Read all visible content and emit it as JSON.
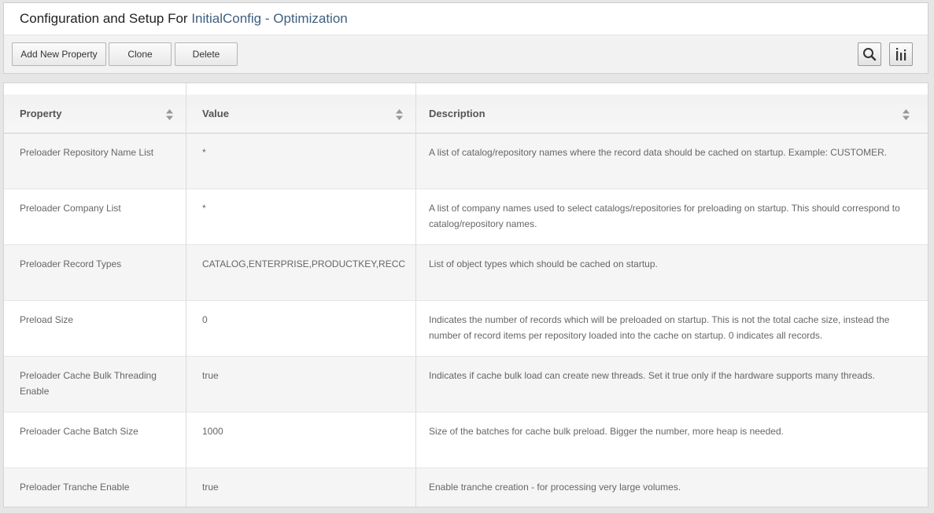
{
  "header": {
    "title_prefix": "Configuration and Setup For ",
    "config_name": "InitialConfig",
    "separator": " - ",
    "section": "Optimization"
  },
  "toolbar": {
    "add_label": "Add New Property",
    "clone_label": "Clone",
    "delete_label": "Delete",
    "search_icon": "search-icon",
    "columns_icon": "columns-icon"
  },
  "table": {
    "columns": [
      "Property",
      "Value",
      "Description"
    ],
    "rows": [
      {
        "property": "Preloader Repository Name List",
        "value": "*",
        "description": "A list of catalog/repository names where the record data should be cached on startup. Example: CUSTOMER."
      },
      {
        "property": "Preloader Company List",
        "value": "*",
        "description": "A list of company names used to select catalogs/repositories for preloading on startup. This should correspond to catalog/repository names."
      },
      {
        "property": "Preloader Record Types",
        "value": "CATALOG,ENTERPRISE,PRODUCTKEY,RECC",
        "description": "List of object types which should be cached on startup."
      },
      {
        "property": "Preload Size",
        "value": "0",
        "description": "Indicates the number of records which will be preloaded on startup. This is not the total cache size, instead the number of record items per repository loaded into the cache on startup. 0 indicates all records."
      },
      {
        "property": "Preloader Cache Bulk Threading Enable",
        "value": "true",
        "description": "Indicates if cache bulk load can create new threads. Set it true only if the hardware supports many threads."
      },
      {
        "property": "Preloader Cache Batch Size",
        "value": "1000",
        "description": "Size of the batches for cache bulk preload. Bigger the number, more heap is needed."
      },
      {
        "property": "Preloader Tranche Enable",
        "value": "true",
        "description": "Enable tranche creation - for processing very large volumes."
      }
    ]
  },
  "colors": {
    "accent": "#3e5f7f",
    "row_alt": "#f5f5f5"
  }
}
